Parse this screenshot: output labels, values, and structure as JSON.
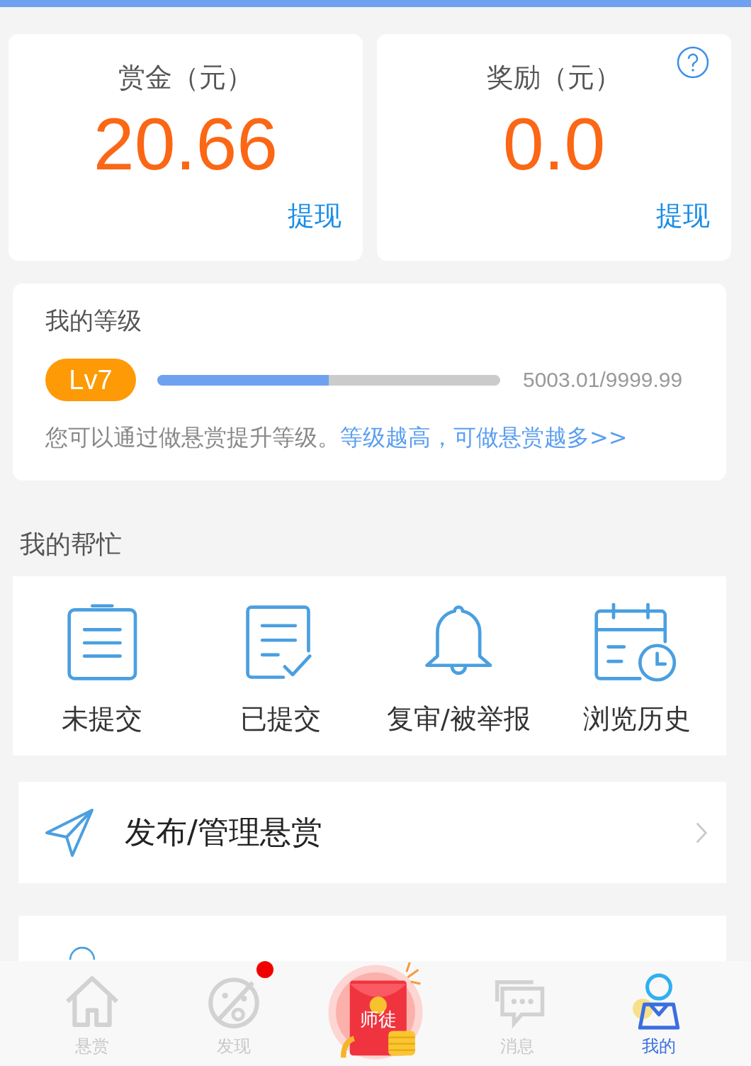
{
  "balances": [
    {
      "label": "赏金（元）",
      "amount": "20.66",
      "action": "提现",
      "help": false
    },
    {
      "label": "奖励（元）",
      "amount": "0.0",
      "action": "提现",
      "help": true
    }
  ],
  "level": {
    "title": "我的等级",
    "badge": "Lv7",
    "level": 0.5,
    "reading": "5003.01/9999.99",
    "hint": "您可以通过做悬赏提升等级。",
    "link": "等级越高，可做悬赏越多>>"
  },
  "help_section": {
    "title": "我的帮忙",
    "items": [
      {
        "label": "未提交",
        "kind": "clipboard"
      },
      {
        "label": "已提交",
        "kind": "checked"
      },
      {
        "label": "复审/被举报",
        "kind": "bell"
      },
      {
        "label": "浏览历史",
        "kind": "calendar"
      }
    ]
  },
  "menu": [
    {
      "label": "发布/管理悬赏",
      "kind": "send"
    },
    {
      "kind": "people"
    }
  ],
  "nav": [
    {
      "label": "悬赏",
      "kind": "home",
      "selected": false,
      "dot": false
    },
    {
      "label": "发现",
      "kind": "planet",
      "selected": false,
      "dot": true
    },
    {
      "label": "师徒",
      "kind": "center",
      "selected": false,
      "dot": false
    },
    {
      "label": "消息",
      "kind": "chat",
      "selected": false,
      "dot": false
    },
    {
      "label": "我的",
      "kind": "user",
      "selected": true,
      "dot": false
    }
  ]
}
